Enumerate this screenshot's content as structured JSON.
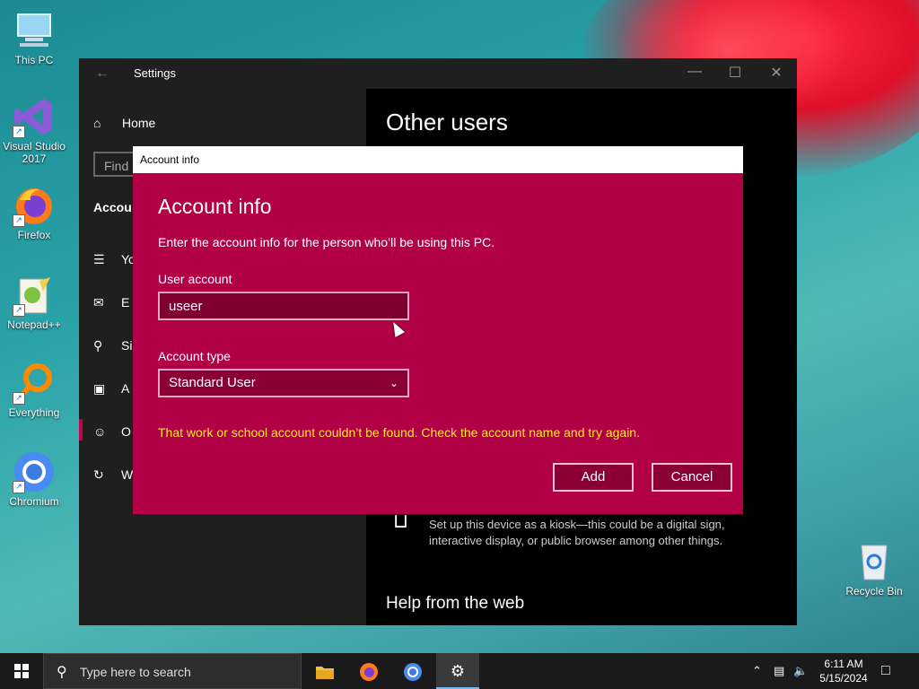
{
  "desktop": {
    "icons": [
      {
        "label": "This PC"
      },
      {
        "label": "Visual Studio 2017"
      },
      {
        "label": "Firefox"
      },
      {
        "label": "Notepad++"
      },
      {
        "label": "Everything"
      },
      {
        "label": "Chromium"
      },
      {
        "label": "Recycle Bin"
      }
    ]
  },
  "settings": {
    "title": "Settings",
    "home_label": "Home",
    "find_placeholder": "Find",
    "section_label": "Accou",
    "nav_items": [
      {
        "label": "Yo",
        "icon": "person-list-icon"
      },
      {
        "label": "E",
        "icon": "mail-icon"
      },
      {
        "label": "Si",
        "icon": "key-icon"
      },
      {
        "label": "A",
        "icon": "briefcase-icon"
      },
      {
        "label": "O",
        "icon": "person-add-icon"
      },
      {
        "label": "W",
        "icon": "sync-icon"
      }
    ],
    "right": {
      "heading": "Other users",
      "kiosk_text": "Set up this device as a kiosk—this could be a digital sign, interactive display, or public browser among other things.",
      "help_heading": "Help from the web"
    }
  },
  "dialog": {
    "titlebar": "Account info",
    "heading": "Account info",
    "description": "Enter the account info for the person who’ll be using this PC.",
    "user_account_label": "User account",
    "user_account_value": "useer",
    "account_type_label": "Account type",
    "account_type_value": "Standard User",
    "error": "That work or school account couldn’t be found. Check the account name and try again.",
    "add_label": "Add",
    "cancel_label": "Cancel",
    "colors": {
      "background": "#b10046",
      "error": "#ffe62e"
    }
  },
  "taskbar": {
    "search_placeholder": "Type here to search",
    "time": "6:11 AM",
    "date": "5/15/2024"
  }
}
